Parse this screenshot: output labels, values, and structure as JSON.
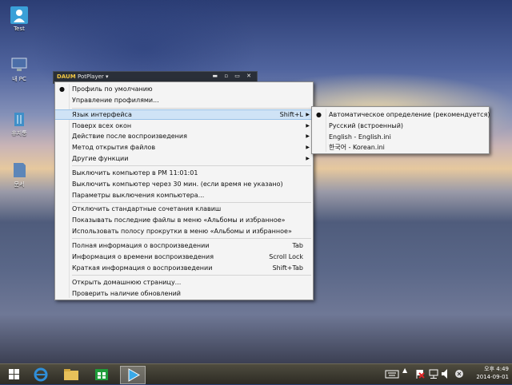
{
  "desktop": {
    "icons": [
      {
        "label": "Test"
      },
      {
        "label": "내 PC"
      },
      {
        "label": "휴지통"
      },
      {
        "label": "문서"
      }
    ]
  },
  "player": {
    "logo": "PotPlayer",
    "title": "PotPlayer ▾"
  },
  "main_menu": {
    "items": [
      {
        "label": "Профиль по умолчанию"
      },
      {
        "label": "Управление профилями..."
      },
      {
        "label": "Язык интерфейса",
        "shortcut": "Shift+L"
      },
      {
        "label": "Поверх всех окон"
      },
      {
        "label": "Действие после воспроизведения"
      },
      {
        "label": "Метод открытия файлов"
      },
      {
        "label": "Другие функции"
      },
      {
        "label": "Выключить компьютер в PM 11:01:01"
      },
      {
        "label": "Выключить компьютер через 30 мин. (если время не указано)"
      },
      {
        "label": "Параметры выключения компьютера..."
      },
      {
        "label": "Отключить стандартные сочетания клавиш"
      },
      {
        "label": "Показывать последние файлы в меню «Альбомы и избранное»"
      },
      {
        "label": "Использовать полосу прокрутки в меню «Альбомы и избранное»"
      },
      {
        "label": "Полная информация о воспроизведении",
        "shortcut": "Tab"
      },
      {
        "label": "Информация о времени воспроизведения",
        "shortcut": "Scroll Lock"
      },
      {
        "label": "Краткая информация о воспроизведении",
        "shortcut": "Shift+Tab"
      },
      {
        "label": "Открыть домашнюю страницу..."
      },
      {
        "label": "Проверить наличие обновлений"
      }
    ]
  },
  "language_menu": {
    "items": [
      {
        "label": "Автоматическое определение (рекомендуется)"
      },
      {
        "label": "Русский (встроенный)"
      },
      {
        "label": "English - English.ini"
      },
      {
        "label": "한국어 - Korean.ini"
      }
    ]
  },
  "taskbar": {
    "clock_time": "오후 4:49",
    "clock_date": "2014-09-01"
  },
  "colors": {
    "menu_highlight": "#cfe3f6",
    "menu_bg": "#f4f4f4",
    "taskbar": "#3a372e"
  }
}
